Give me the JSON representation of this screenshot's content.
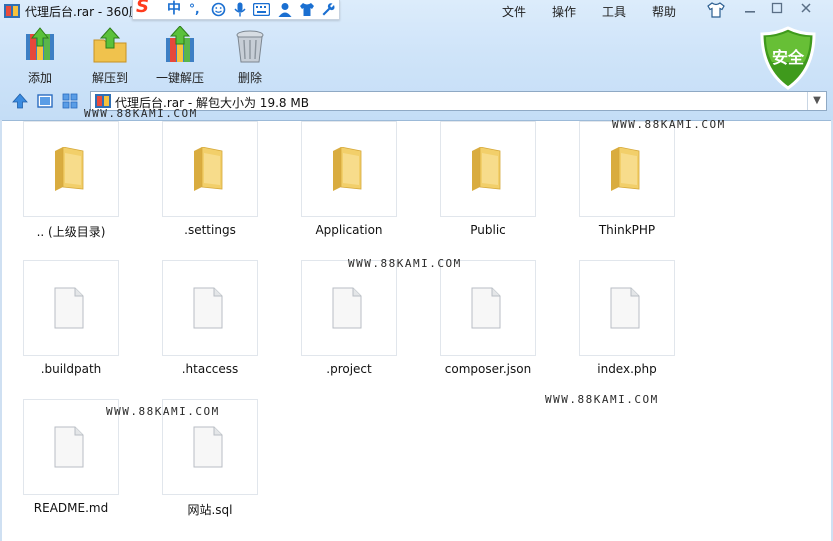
{
  "window": {
    "title": "代理后台.rar - 360压"
  },
  "ime": {
    "logo": "S",
    "mode": "中",
    "punct": "°,",
    "icons": [
      "emoji-icon",
      "microphone-icon",
      "keyboard-icon",
      "user-icon",
      "shirt-icon",
      "wrench-icon"
    ]
  },
  "menu": [
    "文件",
    "操作",
    "工具",
    "帮助"
  ],
  "toolbar": {
    "add": "添加",
    "extract_to": "解压到",
    "one_click_extract": "一键解压",
    "delete": "删除"
  },
  "security_badge": "安全",
  "address": {
    "path": "代理后台.rar - 解包大小为 19.8 MB"
  },
  "files": [
    {
      "name": ".. (上级目录)",
      "type": "folder"
    },
    {
      "name": ".settings",
      "type": "folder"
    },
    {
      "name": "Application",
      "type": "folder"
    },
    {
      "name": "Public",
      "type": "folder"
    },
    {
      "name": "ThinkPHP",
      "type": "folder"
    },
    {
      "name": ".buildpath",
      "type": "file"
    },
    {
      "name": ".htaccess",
      "type": "file"
    },
    {
      "name": ".project",
      "type": "file"
    },
    {
      "name": "composer.json",
      "type": "file"
    },
    {
      "name": "index.php",
      "type": "file"
    },
    {
      "name": "README.md",
      "type": "file"
    },
    {
      "name": "网站.sql",
      "type": "file"
    }
  ],
  "watermark": "WWW.88KAMI.COM",
  "colors": {
    "frame": "#cfe4f9",
    "folder": "#f2cf6a",
    "shield": "#3f9a1c"
  }
}
